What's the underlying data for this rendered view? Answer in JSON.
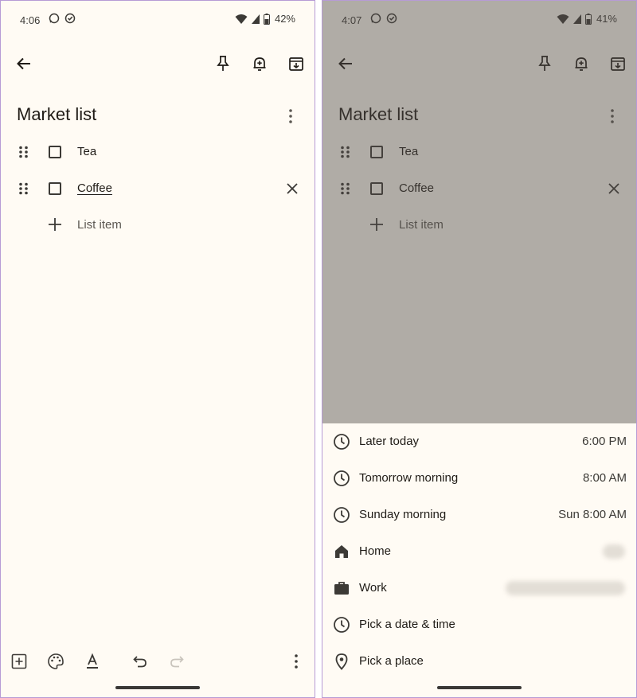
{
  "screens": {
    "left": {
      "status": {
        "time": "4:06",
        "battery": "42%"
      },
      "note_title": "Market list",
      "items": [
        {
          "text": "Tea"
        },
        {
          "text": "Coffee"
        }
      ],
      "add_item_label": "List item"
    },
    "right": {
      "status": {
        "time": "4:07",
        "battery": "41%"
      },
      "note_title": "Market list",
      "items": [
        {
          "text": "Tea"
        },
        {
          "text": "Coffee"
        }
      ],
      "add_item_label": "List item",
      "reminder_menu": [
        {
          "label": "Later today",
          "value": "6:00 PM",
          "icon": "clock-icon"
        },
        {
          "label": "Tomorrow morning",
          "value": "8:00 AM",
          "icon": "clock-icon"
        },
        {
          "label": "Sunday morning",
          "value": "Sun 8:00 AM",
          "icon": "clock-icon"
        },
        {
          "label": "Home",
          "value": "",
          "icon": "home-icon"
        },
        {
          "label": "Work",
          "value": "",
          "icon": "briefcase-icon"
        },
        {
          "label": "Pick a date & time",
          "value": "",
          "icon": "clock-icon"
        },
        {
          "label": "Pick a place",
          "value": "",
          "icon": "location-pin-icon"
        }
      ]
    }
  },
  "colors": {
    "background": "#fffbf4",
    "text": "#1f1b16",
    "scrim": "#aca8a3",
    "frame_border": "#b79bd6"
  }
}
